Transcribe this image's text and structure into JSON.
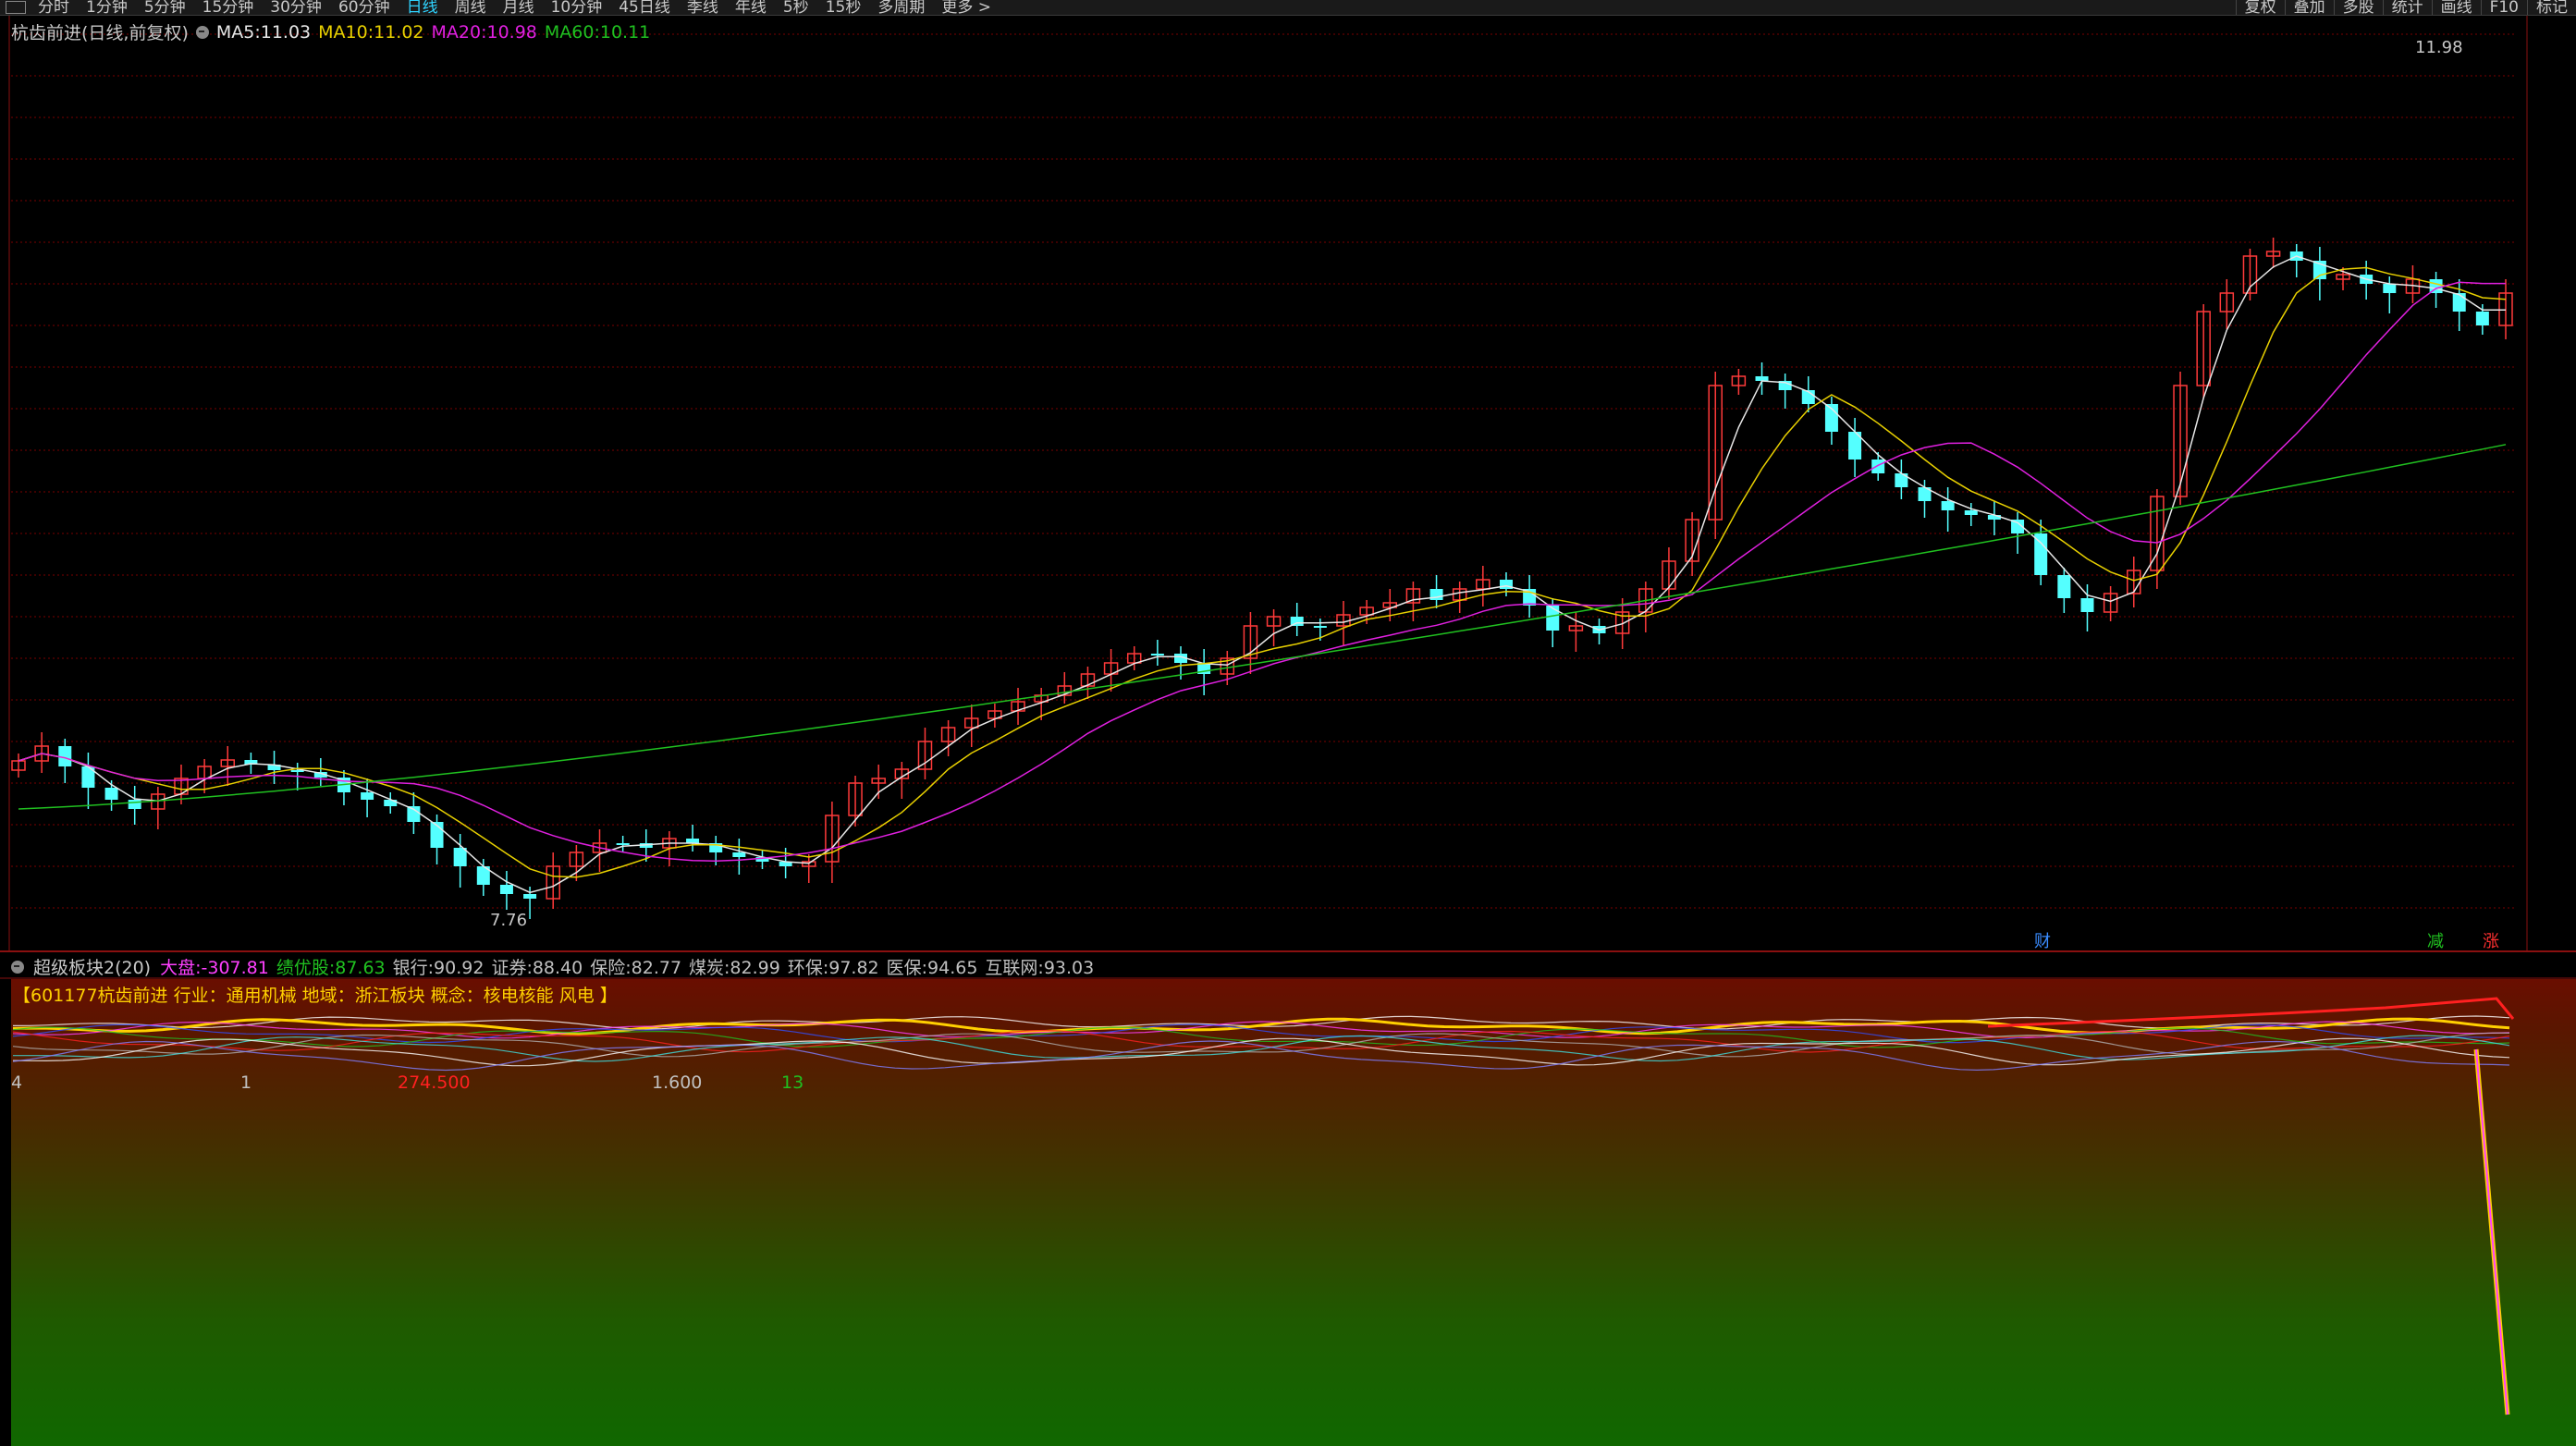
{
  "toolbar": {
    "periods": [
      "分时",
      "1分钟",
      "5分钟",
      "15分钟",
      "30分钟",
      "60分钟",
      "日线",
      "周线",
      "月线",
      "10分钟",
      "45日线",
      "季线",
      "年线",
      "5秒",
      "15秒",
      "多周期",
      "更多 >"
    ],
    "active_period": "日线",
    "tools": [
      "复权",
      "叠加",
      "多股",
      "统计",
      "画线",
      "F10",
      "标记"
    ]
  },
  "main_chart": {
    "title": "杭齿前进(日线,前复权)",
    "ma": [
      {
        "label": "MA5:",
        "value": "11.03",
        "color": "#e8e8e8"
      },
      {
        "label": "MA10:",
        "value": "11.02",
        "color": "#e8d000"
      },
      {
        "label": "MA20:",
        "value": "10.98",
        "color": "#e020e0"
      },
      {
        "label": "MA60:",
        "value": "10.11",
        "color": "#20c020"
      }
    ],
    "high_label": "11.98",
    "low_label": "7.76",
    "event_markers": [
      {
        "text": "财",
        "color": "#3a8cff"
      },
      {
        "text": "减",
        "color": "#20c020"
      },
      {
        "text": "涨",
        "color": "#ff3030"
      }
    ],
    "colors": {
      "up": "#ff3a3a",
      "down": "#54ffff",
      "grid": "#7a0000"
    }
  },
  "sub_panel": {
    "title": "超级板块2(20)",
    "items": [
      {
        "label": "大盘:",
        "value": "-307.81",
        "color": "#ff40ff"
      },
      {
        "label": "绩优股:",
        "value": "87.63",
        "color": "#20c020"
      },
      {
        "label": "银行:",
        "value": "90.92",
        "color": "#c0c0c0"
      },
      {
        "label": "证券:",
        "value": "88.40",
        "color": "#c0c0c0"
      },
      {
        "label": "保险:",
        "value": "82.77",
        "color": "#c0c0c0"
      },
      {
        "label": "煤炭:",
        "value": "82.99",
        "color": "#c0c0c0"
      },
      {
        "label": "环保:",
        "value": "97.82",
        "color": "#c0c0c0"
      },
      {
        "label": "医保:",
        "value": "94.65",
        "color": "#c0c0c0"
      },
      {
        "label": "互联网:",
        "value": "93.03",
        "color": "#c0c0c0"
      }
    ],
    "stock_info": "【601177杭齿前进 行业：通用机械 地域：浙江板块 概念：核电核能 风电 】",
    "readouts": [
      {
        "text": "4",
        "color": "#c0c0c0"
      },
      {
        "text": "1",
        "color": "#c0c0c0"
      },
      {
        "text": "274.500",
        "color": "#ff2020"
      },
      {
        "text": "1.600",
        "color": "#c0c0c0"
      },
      {
        "text": "13",
        "color": "#20c020"
      }
    ]
  }
}
